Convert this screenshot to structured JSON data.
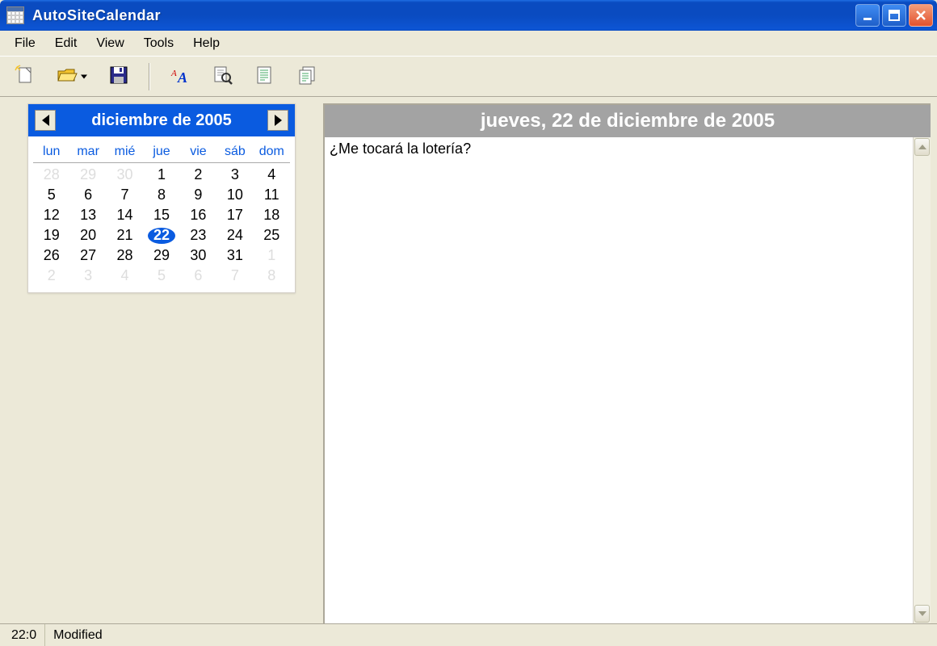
{
  "window": {
    "title": "AutoSiteCalendar"
  },
  "menubar": {
    "items": [
      "File",
      "Edit",
      "View",
      "Tools",
      "Help"
    ]
  },
  "toolbar": {
    "new": "new-document",
    "open": "open-file",
    "save": "save",
    "font": "font-style",
    "preview": "preview",
    "page": "page-setup",
    "pages": "multi-page"
  },
  "calendar": {
    "title": "diciembre de 2005",
    "dow": [
      "lun",
      "mar",
      "mié",
      "jue",
      "vie",
      "sáb",
      "dom"
    ],
    "weeks": [
      [
        {
          "d": 28,
          "m": 1
        },
        {
          "d": 29,
          "m": 1
        },
        {
          "d": 30,
          "m": 1
        },
        {
          "d": 1
        },
        {
          "d": 2
        },
        {
          "d": 3
        },
        {
          "d": 4
        }
      ],
      [
        {
          "d": 5
        },
        {
          "d": 6
        },
        {
          "d": 7
        },
        {
          "d": 8
        },
        {
          "d": 9
        },
        {
          "d": 10
        },
        {
          "d": 11
        }
      ],
      [
        {
          "d": 12
        },
        {
          "d": 13
        },
        {
          "d": 14
        },
        {
          "d": 15
        },
        {
          "d": 16
        },
        {
          "d": 17
        },
        {
          "d": 18
        }
      ],
      [
        {
          "d": 19
        },
        {
          "d": 20
        },
        {
          "d": 21
        },
        {
          "d": 22,
          "sel": 1
        },
        {
          "d": 23
        },
        {
          "d": 24
        },
        {
          "d": 25
        }
      ],
      [
        {
          "d": 26
        },
        {
          "d": 27
        },
        {
          "d": 28
        },
        {
          "d": 29
        },
        {
          "d": 30
        },
        {
          "d": 31
        },
        {
          "d": 1,
          "m": 1
        }
      ],
      [
        {
          "d": 2,
          "m": 1
        },
        {
          "d": 3,
          "m": 1
        },
        {
          "d": 4,
          "m": 1
        },
        {
          "d": 5,
          "m": 1
        },
        {
          "d": 6,
          "m": 1
        },
        {
          "d": 7,
          "m": 1
        },
        {
          "d": 8,
          "m": 1
        }
      ]
    ]
  },
  "entry": {
    "date_header": "jueves, 22 de diciembre de 2005",
    "text": "¿Me tocará la lotería?"
  },
  "status": {
    "pos": "22:0",
    "state": "Modified"
  }
}
